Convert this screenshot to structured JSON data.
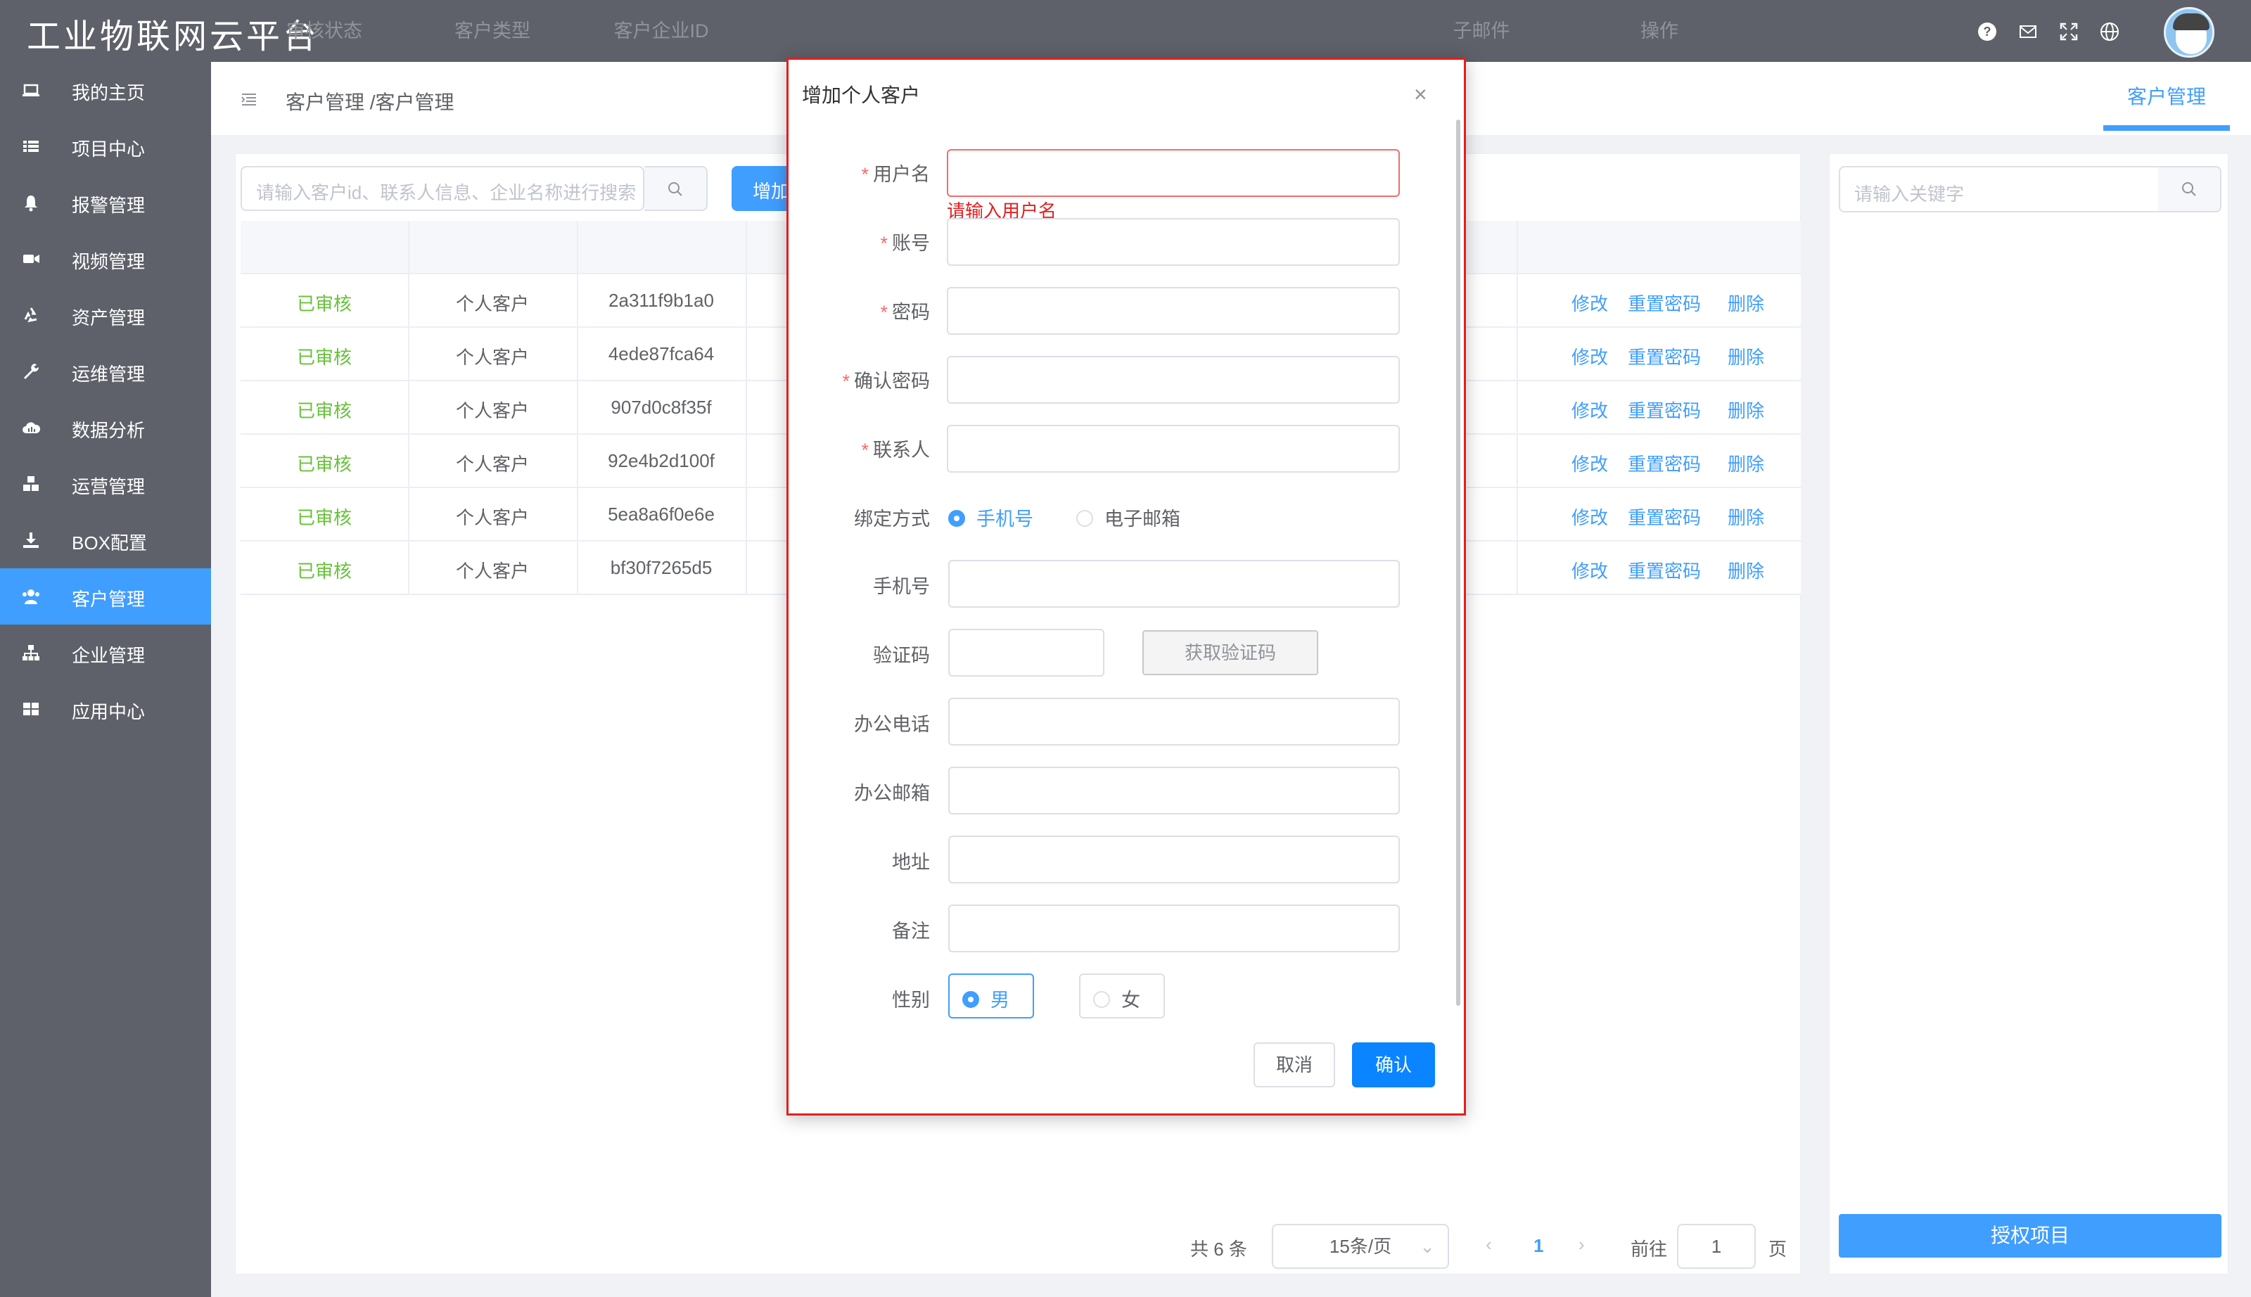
{
  "app": {
    "title": "工业物联网云平台"
  },
  "topbar": {
    "icons": [
      "help-icon",
      "mail-icon",
      "fullscreen-icon",
      "globe-icon"
    ]
  },
  "sidebar": {
    "items": [
      {
        "label": "我的主页",
        "icon": "laptop-icon"
      },
      {
        "label": "项目中心",
        "icon": "list-icon"
      },
      {
        "label": "报警管理",
        "icon": "bell-icon"
      },
      {
        "label": "视频管理",
        "icon": "video-icon"
      },
      {
        "label": "资产管理",
        "icon": "recycle-icon"
      },
      {
        "label": "运维管理",
        "icon": "wrench-icon"
      },
      {
        "label": "数据分析",
        "icon": "cloud-chart-icon"
      },
      {
        "label": "运营管理",
        "icon": "cubes-icon"
      },
      {
        "label": "BOX配置",
        "icon": "download-icon"
      },
      {
        "label": "客户管理",
        "icon": "users-icon",
        "active": true
      },
      {
        "label": "企业管理",
        "icon": "sitemap-icon"
      },
      {
        "label": "应用中心",
        "icon": "grid-icon"
      }
    ]
  },
  "header": {
    "breadcrumb": "客户管理 /客户管理",
    "tab": "客户管理"
  },
  "toolbar": {
    "search_placeholder": "请输入客户id、联系人信息、企业名称进行搜索",
    "add_label": "增加"
  },
  "table": {
    "headers": [
      "审核状态",
      "客户类型",
      "客户企业ID",
      "子邮件",
      "操作"
    ],
    "rows": [
      {
        "status": "已审核",
        "type": "个人客户",
        "id": "2a311f9b1a0"
      },
      {
        "status": "已审核",
        "type": "个人客户",
        "id": "4ede87fca64"
      },
      {
        "status": "已审核",
        "type": "个人客户",
        "id": "907d0c8f35f"
      },
      {
        "status": "已审核",
        "type": "个人客户",
        "id": "92e4b2d100f"
      },
      {
        "status": "已审核",
        "type": "个人客户",
        "id": "5ea8a6f0e6e"
      },
      {
        "status": "已审核",
        "type": "个人客户",
        "id": "bf30f7265d5"
      }
    ],
    "ops": [
      "修改",
      "重置密码",
      "删除"
    ]
  },
  "pagination": {
    "total": "共 6 条",
    "page_size": "15条/页",
    "current": "1",
    "goto_label": "前往",
    "goto_value": "1",
    "page_unit": "页"
  },
  "right_panel": {
    "keyword_placeholder": "请输入关键字",
    "authorize_label": "授权项目"
  },
  "dialog": {
    "title": "增加个人客户",
    "fields": {
      "username": "用户名",
      "username_error": "请输入用户名",
      "account": "账号",
      "password": "密码",
      "confirm_password": "确认密码",
      "contact": "联系人",
      "bind_method": "绑定方式",
      "bind_phone": "手机号",
      "bind_email": "电子邮箱",
      "phone": "手机号",
      "verify_code": "验证码",
      "get_code": "获取验证码",
      "office_phone": "办公电话",
      "office_email": "办公邮箱",
      "address": "地址",
      "remark": "备注",
      "gender": "性别",
      "male": "男",
      "female": "女"
    },
    "cancel_label": "取消",
    "confirm_label": "确认"
  }
}
